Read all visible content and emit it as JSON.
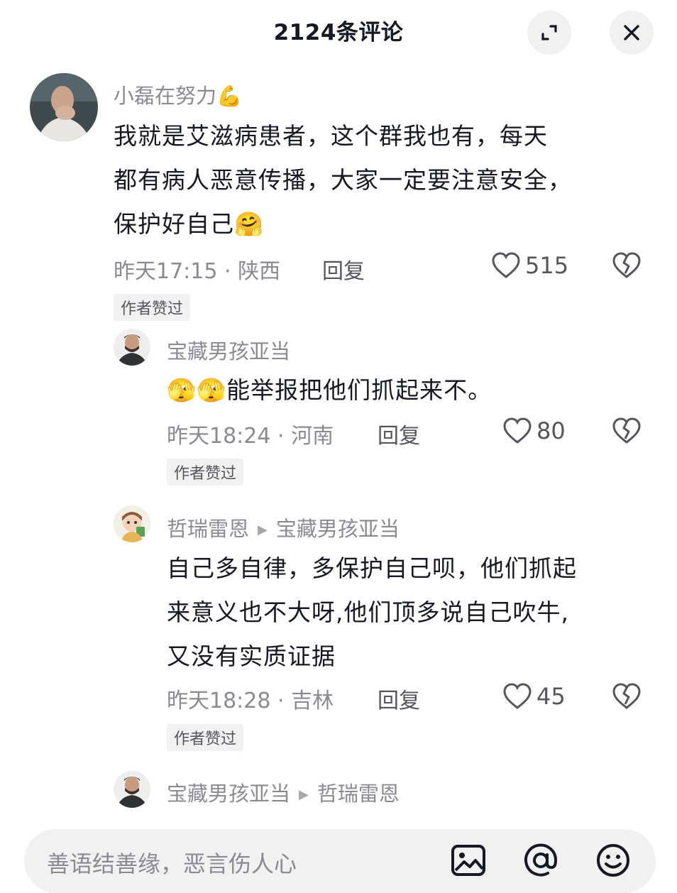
{
  "header": {
    "title": "2124条评论"
  },
  "comments": [
    {
      "name": "小磊在努力",
      "name_emoji": "💪",
      "lines": [
        "我就是艾滋病患者，这个群我也有，每天",
        "都有病人恶意传播，大家一定要注意安全，",
        "保护好自己🤗"
      ],
      "time_location": "昨天17:15 · 陕西",
      "reply_label": "回复",
      "likes": "515",
      "badge": "作者赞过"
    },
    {
      "name": "宝藏男孩亚当",
      "lines": [
        "🫣🫣能举报把他们抓起来不。"
      ],
      "time_location": "昨天18:24 · 河南",
      "reply_label": "回复",
      "likes": "80",
      "badge": "作者赞过"
    },
    {
      "name": "哲瑞雷恩",
      "reply_to": "宝藏男孩亚当",
      "lines": [
        "自己多自律，多保护自己呗，他们抓起",
        "来意义也不大呀,他们顶多说自己吹牛,",
        "又没有实质证据"
      ],
      "time_location": "昨天18:28 · 吉林",
      "reply_label": "回复",
      "likes": "45",
      "badge": "作者赞过"
    },
    {
      "name": "宝藏男孩亚当",
      "reply_to": "哲瑞雷恩"
    }
  ],
  "input": {
    "placeholder": "善语结善缘，恶言伤人心"
  },
  "icons": {
    "expand": "expand-icon",
    "close": "close-icon",
    "like": "heart-outline-icon",
    "dislike": "broken-heart-icon",
    "image": "image-icon",
    "mention": "at-icon",
    "emoji": "emoji-icon"
  }
}
